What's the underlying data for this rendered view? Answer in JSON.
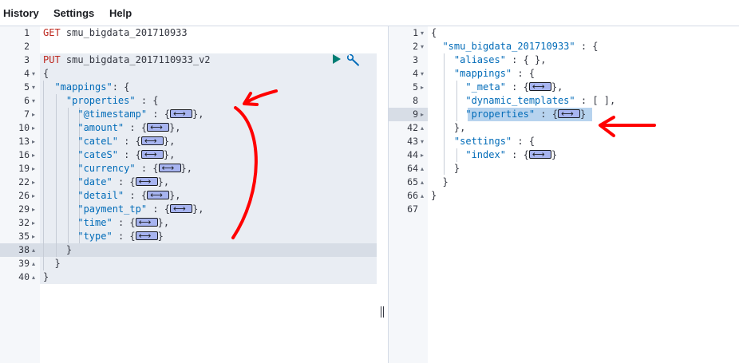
{
  "menu": {
    "history": "History",
    "settings": "Settings",
    "help": "Help"
  },
  "left_editor": {
    "lines": [
      {
        "num": "1",
        "fold": "",
        "parts": [
          {
            "c": "m",
            "t": "GET "
          },
          {
            "c": "u",
            "t": "smu_bigdata_201710933"
          }
        ]
      },
      {
        "num": "2",
        "fold": "",
        "parts": []
      },
      {
        "num": "3",
        "fold": "",
        "parts": [
          {
            "c": "m",
            "t": "PUT "
          },
          {
            "c": "u",
            "t": "smu_bigdata_2017110933_v2"
          }
        ]
      },
      {
        "num": "4",
        "fold": "open",
        "parts": [
          {
            "c": "p",
            "t": "{"
          }
        ]
      },
      {
        "num": "5",
        "fold": "open",
        "parts": [
          {
            "c": "p",
            "t": "  "
          },
          {
            "c": "k",
            "t": "\"mappings\""
          },
          {
            "c": "p",
            "t": ": {"
          }
        ]
      },
      {
        "num": "6",
        "fold": "open",
        "parts": [
          {
            "c": "p",
            "t": "    "
          },
          {
            "c": "k",
            "t": "\"properties\""
          },
          {
            "c": "p",
            "t": " : {"
          }
        ]
      },
      {
        "num": "7",
        "fold": "closed",
        "parts": [
          {
            "c": "p",
            "t": "      "
          },
          {
            "c": "k",
            "t": "\"@timestamp\""
          },
          {
            "c": "p",
            "t": " : {"
          },
          {
            "c": "box"
          },
          {
            "c": "p",
            "t": "},"
          }
        ]
      },
      {
        "num": "10",
        "fold": "closed",
        "parts": [
          {
            "c": "p",
            "t": "      "
          },
          {
            "c": "k",
            "t": "\"amount\""
          },
          {
            "c": "p",
            "t": " : {"
          },
          {
            "c": "box"
          },
          {
            "c": "p",
            "t": "},"
          }
        ]
      },
      {
        "num": "13",
        "fold": "closed",
        "parts": [
          {
            "c": "p",
            "t": "      "
          },
          {
            "c": "k",
            "t": "\"cateL\""
          },
          {
            "c": "p",
            "t": " : {"
          },
          {
            "c": "box"
          },
          {
            "c": "p",
            "t": "},"
          }
        ]
      },
      {
        "num": "16",
        "fold": "closed",
        "parts": [
          {
            "c": "p",
            "t": "      "
          },
          {
            "c": "k",
            "t": "\"cateS\""
          },
          {
            "c": "p",
            "t": " : {"
          },
          {
            "c": "box"
          },
          {
            "c": "p",
            "t": "},"
          }
        ]
      },
      {
        "num": "19",
        "fold": "closed",
        "parts": [
          {
            "c": "p",
            "t": "      "
          },
          {
            "c": "k",
            "t": "\"currency\""
          },
          {
            "c": "p",
            "t": " : {"
          },
          {
            "c": "box"
          },
          {
            "c": "p",
            "t": "},"
          }
        ]
      },
      {
        "num": "22",
        "fold": "closed",
        "parts": [
          {
            "c": "p",
            "t": "      "
          },
          {
            "c": "k",
            "t": "\"date\""
          },
          {
            "c": "p",
            "t": " : {"
          },
          {
            "c": "box"
          },
          {
            "c": "p",
            "t": "},"
          }
        ]
      },
      {
        "num": "26",
        "fold": "closed",
        "parts": [
          {
            "c": "p",
            "t": "      "
          },
          {
            "c": "k",
            "t": "\"detail\""
          },
          {
            "c": "p",
            "t": " : {"
          },
          {
            "c": "box"
          },
          {
            "c": "p",
            "t": "},"
          }
        ]
      },
      {
        "num": "29",
        "fold": "closed",
        "parts": [
          {
            "c": "p",
            "t": "      "
          },
          {
            "c": "k",
            "t": "\"payment_tp\""
          },
          {
            "c": "p",
            "t": " : {"
          },
          {
            "c": "box"
          },
          {
            "c": "p",
            "t": "},"
          }
        ]
      },
      {
        "num": "32",
        "fold": "closed",
        "parts": [
          {
            "c": "p",
            "t": "      "
          },
          {
            "c": "k",
            "t": "\"time\""
          },
          {
            "c": "p",
            "t": " : {"
          },
          {
            "c": "box"
          },
          {
            "c": "p",
            "t": "},"
          }
        ]
      },
      {
        "num": "35",
        "fold": "closed",
        "parts": [
          {
            "c": "p",
            "t": "      "
          },
          {
            "c": "k",
            "t": "\"type\""
          },
          {
            "c": "p",
            "t": " : {"
          },
          {
            "c": "box"
          },
          {
            "c": "p",
            "t": "}"
          }
        ]
      },
      {
        "num": "38",
        "fold": "up",
        "parts": [
          {
            "c": "p",
            "t": "    }"
          }
        ]
      },
      {
        "num": "39",
        "fold": "up",
        "parts": [
          {
            "c": "p",
            "t": "  }"
          }
        ]
      },
      {
        "num": "40",
        "fold": "up",
        "parts": [
          {
            "c": "p",
            "t": "}"
          }
        ]
      }
    ]
  },
  "right_editor": {
    "lines": [
      {
        "num": "1",
        "fold": "open",
        "parts": [
          {
            "c": "p",
            "t": "{"
          }
        ]
      },
      {
        "num": "2",
        "fold": "open",
        "parts": [
          {
            "c": "p",
            "t": "  "
          },
          {
            "c": "k",
            "t": "\"smu_bigdata_201710933\""
          },
          {
            "c": "p",
            "t": " : {"
          }
        ]
      },
      {
        "num": "3",
        "fold": "",
        "parts": [
          {
            "c": "p",
            "t": "    "
          },
          {
            "c": "k",
            "t": "\"aliases\""
          },
          {
            "c": "p",
            "t": " : { },"
          }
        ]
      },
      {
        "num": "4",
        "fold": "open",
        "parts": [
          {
            "c": "p",
            "t": "    "
          },
          {
            "c": "k",
            "t": "\"mappings\""
          },
          {
            "c": "p",
            "t": " : {"
          }
        ]
      },
      {
        "num": "5",
        "fold": "closed",
        "parts": [
          {
            "c": "p",
            "t": "      "
          },
          {
            "c": "k",
            "t": "\"_meta\""
          },
          {
            "c": "p",
            "t": " : {"
          },
          {
            "c": "box"
          },
          {
            "c": "p",
            "t": "},"
          }
        ]
      },
      {
        "num": "8",
        "fold": "",
        "parts": [
          {
            "c": "p",
            "t": "      "
          },
          {
            "c": "k",
            "t": "\"dynamic_templates\""
          },
          {
            "c": "p",
            "t": " : [ ],"
          }
        ]
      },
      {
        "num": "9",
        "fold": "closed",
        "parts": [
          {
            "c": "p",
            "t": "      "
          },
          {
            "c": "k",
            "t": "\"properties\""
          },
          {
            "c": "p",
            "t": " : {"
          },
          {
            "c": "box"
          },
          {
            "c": "p",
            "t": "}"
          }
        ]
      },
      {
        "num": "42",
        "fold": "up",
        "parts": [
          {
            "c": "p",
            "t": "    },"
          }
        ]
      },
      {
        "num": "43",
        "fold": "open",
        "parts": [
          {
            "c": "p",
            "t": "    "
          },
          {
            "c": "k",
            "t": "\"settings\""
          },
          {
            "c": "p",
            "t": " : {"
          }
        ]
      },
      {
        "num": "44",
        "fold": "closed",
        "parts": [
          {
            "c": "p",
            "t": "      "
          },
          {
            "c": "k",
            "t": "\"index\""
          },
          {
            "c": "p",
            "t": " : {"
          },
          {
            "c": "box"
          },
          {
            "c": "p",
            "t": "}"
          }
        ]
      },
      {
        "num": "64",
        "fold": "up",
        "parts": [
          {
            "c": "p",
            "t": "    }"
          }
        ]
      },
      {
        "num": "65",
        "fold": "up",
        "parts": [
          {
            "c": "p",
            "t": "  }"
          }
        ]
      },
      {
        "num": "66",
        "fold": "up",
        "parts": [
          {
            "c": "p",
            "t": "}"
          }
        ]
      },
      {
        "num": "67",
        "fold": "",
        "parts": []
      }
    ]
  },
  "icons": {
    "run": "play-icon",
    "settings": "wrench-icon",
    "annotation": "hand-drawn-red-arrow"
  },
  "colors": {
    "key": "#006bb8",
    "method": "#bd271e",
    "annotation": "#ff0000",
    "gutter": "#f5f7fa",
    "selection": "#b7d3ee",
    "request_bg": "#e9edf3"
  }
}
